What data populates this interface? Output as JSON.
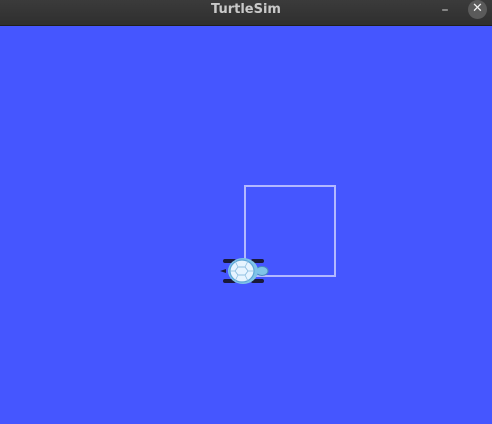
{
  "window": {
    "title": "TurtleSim",
    "minimize_glyph": "–",
    "close_glyph": "✕"
  },
  "canvas": {
    "background_color": "#4556ff",
    "trail_color": "#b3b8ff"
  },
  "turtle": {
    "icon": "turtle-icon",
    "shell_color": "#e6f4ff",
    "body_color": "#7fc3e8",
    "leg_color": "#1a1a3a"
  }
}
